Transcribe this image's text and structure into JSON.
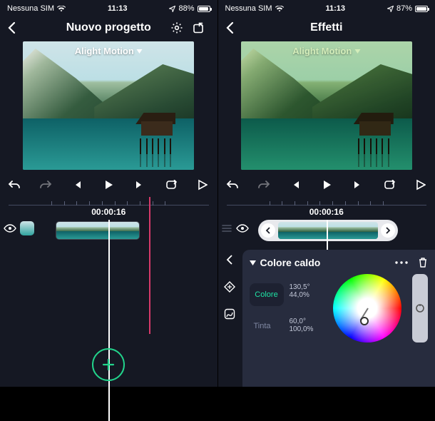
{
  "left": {
    "status": {
      "carrier": "Nessuna SIM",
      "time": "11:13",
      "battery_pct": "88%"
    },
    "navbar": {
      "title": "Nuovo progetto"
    },
    "preview_overlay": "Alight Motion",
    "timecode": "00:00:16"
  },
  "right": {
    "status": {
      "carrier": "Nessuna SIM",
      "time": "11:13",
      "battery_pct": "87%"
    },
    "navbar": {
      "title": "Effetti"
    },
    "preview_overlay": "Alight Motion",
    "timecode": "00:00:16",
    "panel": {
      "title": "Colore caldo",
      "rows": {
        "color": {
          "label": "Colore",
          "deg": "130,5°",
          "pct": "44,0%"
        },
        "tint": {
          "label": "Tinta",
          "deg": "60,0°",
          "pct": "100,0%"
        }
      }
    }
  }
}
